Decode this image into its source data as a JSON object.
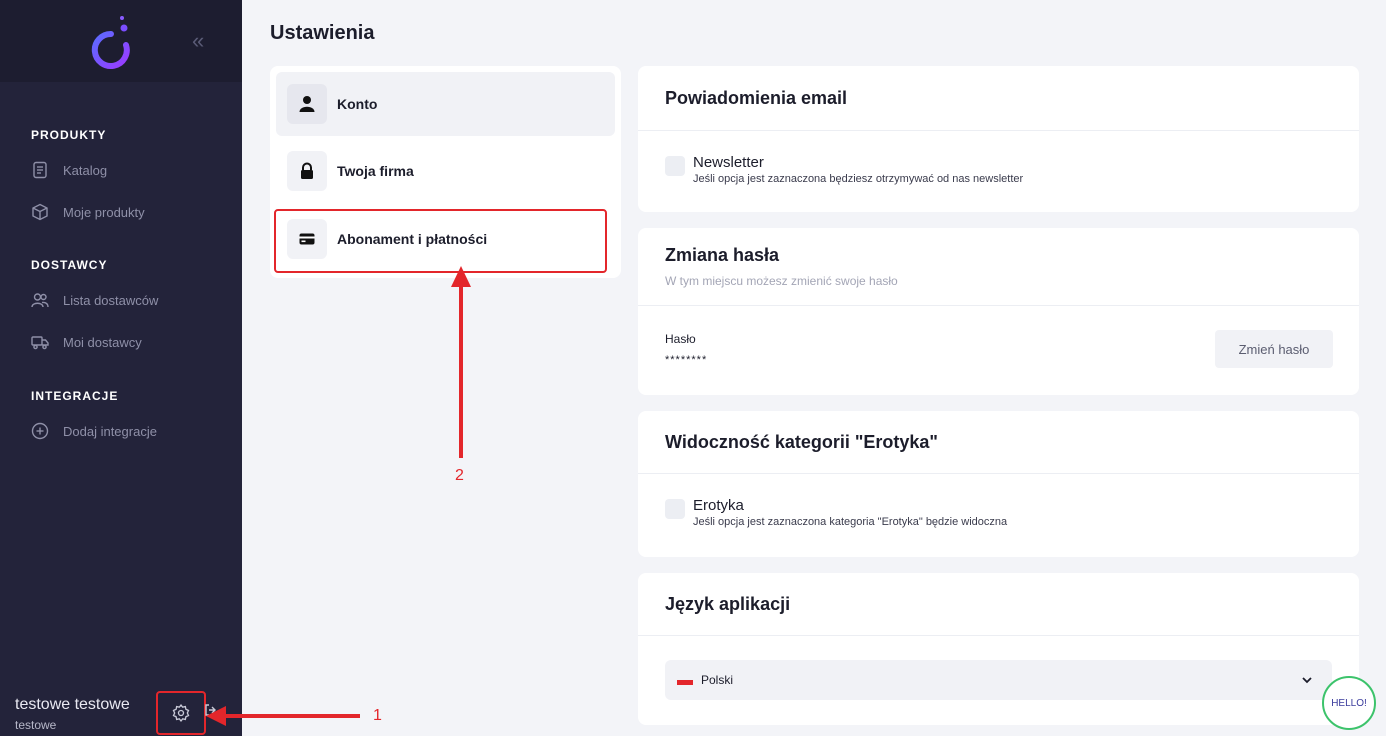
{
  "page": {
    "title": "Ustawienia"
  },
  "sidebar": {
    "sections": [
      {
        "title": "PRODUKTY",
        "items": [
          {
            "label": "Katalog",
            "icon": "catalog-icon"
          },
          {
            "label": "Moje produkty",
            "icon": "box-icon"
          }
        ]
      },
      {
        "title": "DOSTAWCY",
        "items": [
          {
            "label": "Lista dostawców",
            "icon": "users-icon"
          },
          {
            "label": "Moi dostawcy",
            "icon": "truck-icon"
          }
        ]
      },
      {
        "title": "INTEGRACJE",
        "items": [
          {
            "label": "Dodaj integracje",
            "icon": "plus-circle-icon"
          }
        ]
      }
    ],
    "user": {
      "name": "testowe testowe",
      "sub": "testowe"
    }
  },
  "settings_menu": {
    "items": [
      {
        "label": "Konto",
        "icon": "user-icon",
        "active": true
      },
      {
        "label": "Twoja firma",
        "icon": "lock-icon",
        "active": false
      },
      {
        "label": "Abonament i płatności",
        "icon": "card-icon",
        "active": false
      }
    ]
  },
  "email_card": {
    "title": "Powiadomienia email",
    "newsletter": {
      "label": "Newsletter",
      "desc": "Jeśli opcja jest zaznaczona będziesz otrzymywać od nas newsletter",
      "checked": false
    }
  },
  "password_card": {
    "title": "Zmiana hasła",
    "subtitle": "W tym miejscu możesz zmienić swoje hasło",
    "field_label": "Hasło",
    "field_value": "********",
    "button": "Zmień hasło"
  },
  "erotyka_card": {
    "title": "Widoczność kategorii \"Erotyka\"",
    "option": {
      "label": "Erotyka",
      "desc": "Jeśli opcja jest zaznaczona kategoria \"Erotyka\" będzie widoczna",
      "checked": false
    }
  },
  "language_card": {
    "title": "Język aplikacji",
    "selected": "Polski"
  },
  "chat": {
    "label": "HELLO!"
  },
  "annotations": {
    "num1": "1",
    "num2": "2"
  },
  "colors": {
    "accent_red": "#e3262b",
    "sidebar_bg": "#23233a",
    "logo_purple": "#7b4dff",
    "chat_green": "#3cc36b"
  }
}
